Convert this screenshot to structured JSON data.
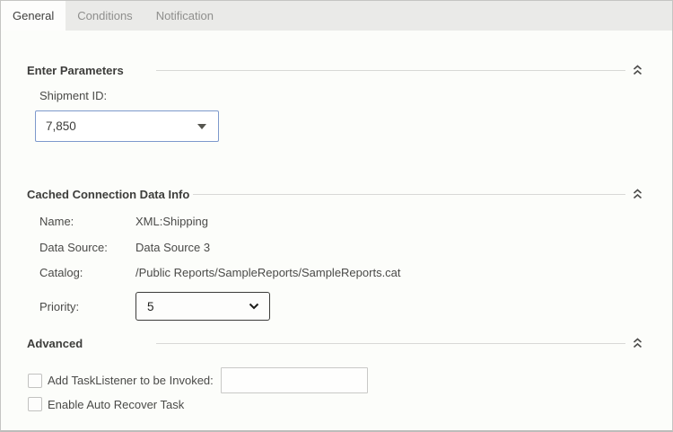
{
  "tabs": [
    {
      "label": "General",
      "active": true
    },
    {
      "label": "Conditions",
      "active": false
    },
    {
      "label": "Notification",
      "active": false
    }
  ],
  "sections": {
    "enter_parameters": {
      "title": "Enter Parameters"
    },
    "cached_info": {
      "title": "Cached Connection Data Info"
    },
    "advanced": {
      "title": "Advanced"
    }
  },
  "fields": {
    "shipment_id": {
      "label": "Shipment ID:",
      "value": "7,850"
    },
    "info_rows": [
      {
        "label": "Name:",
        "value": "XML:Shipping"
      },
      {
        "label": "Data Source:",
        "value": "Data Source 3"
      },
      {
        "label": "Catalog:",
        "value": "/Public Reports/SampleReports/SampleReports.cat"
      }
    ],
    "priority": {
      "label": "Priority:",
      "value": "5"
    },
    "task_listener": {
      "label": "Add TaskListener to be Invoked:",
      "value": "",
      "checked": false
    },
    "auto_recover": {
      "label": "Enable Auto Recover Task",
      "checked": false
    }
  },
  "icons": {
    "collapse": "double-chevron-up",
    "combo_caret": "triangle-down",
    "select_chevron": "chevron-down"
  },
  "colors": {
    "tabbar_bg": "#eaeae8",
    "content_bg": "#fcfdfa",
    "combo_border": "#7d99cc",
    "select_border": "#3c3c3a",
    "rule": "#d8d8d6",
    "text": "#4a4a48",
    "heading": "#3d3d3b",
    "inactive_tab_text": "#8f8f8d",
    "outer_border": "#c5c5c3"
  }
}
